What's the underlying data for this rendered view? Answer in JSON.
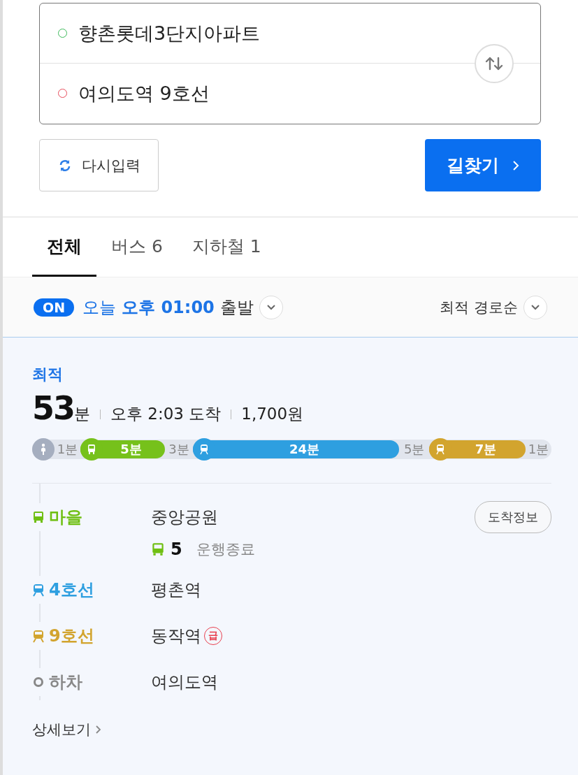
{
  "route_input": {
    "origin": "향촌롯데3단지아파트",
    "destination": "여의도역 9호선"
  },
  "reset_button": "다시입력",
  "search_button": "길찾기",
  "tabs": [
    {
      "label": "전체",
      "selected": true
    },
    {
      "label": "버스 6",
      "selected": false
    },
    {
      "label": "지하철 1",
      "selected": false
    }
  ],
  "options": {
    "on": true,
    "on_label": "ON",
    "day": "오늘",
    "time": "오후 01:00",
    "suffix": "출발",
    "sort": "최적 경로순"
  },
  "route": {
    "tag": "최적",
    "duration": "53",
    "duration_unit": "분",
    "arrival": "오후 2:03 도착",
    "fare": "1,700원",
    "segments": [
      {
        "kind": "walk",
        "label": "1분"
      },
      {
        "kind": "bus",
        "label": "5분",
        "color": "#76c11b"
      },
      {
        "kind": "walk",
        "label": "3분"
      },
      {
        "kind": "subway",
        "label": "24분",
        "color": "#2e9fe0"
      },
      {
        "kind": "walk",
        "label": "5분"
      },
      {
        "kind": "subway",
        "label": "7분",
        "color": "#d2a42e"
      },
      {
        "kind": "walk",
        "label": "1분"
      }
    ],
    "legs": [
      {
        "kind": "bus",
        "mode": "마을",
        "color": "#6fbf12",
        "station": "중앙공원",
        "button": "도착정보",
        "bus_number": "5",
        "bus_status": "운행종료"
      },
      {
        "kind": "subway",
        "mode": "4호선",
        "color": "#2e9fe0",
        "station": "평촌역"
      },
      {
        "kind": "subway",
        "mode": "9호선",
        "color": "#d2a42e",
        "station": "동작역",
        "badge": "급"
      },
      {
        "kind": "alight",
        "mode": "하차",
        "color": "#888888",
        "station": "여의도역"
      }
    ],
    "details_link": "상세보기"
  }
}
